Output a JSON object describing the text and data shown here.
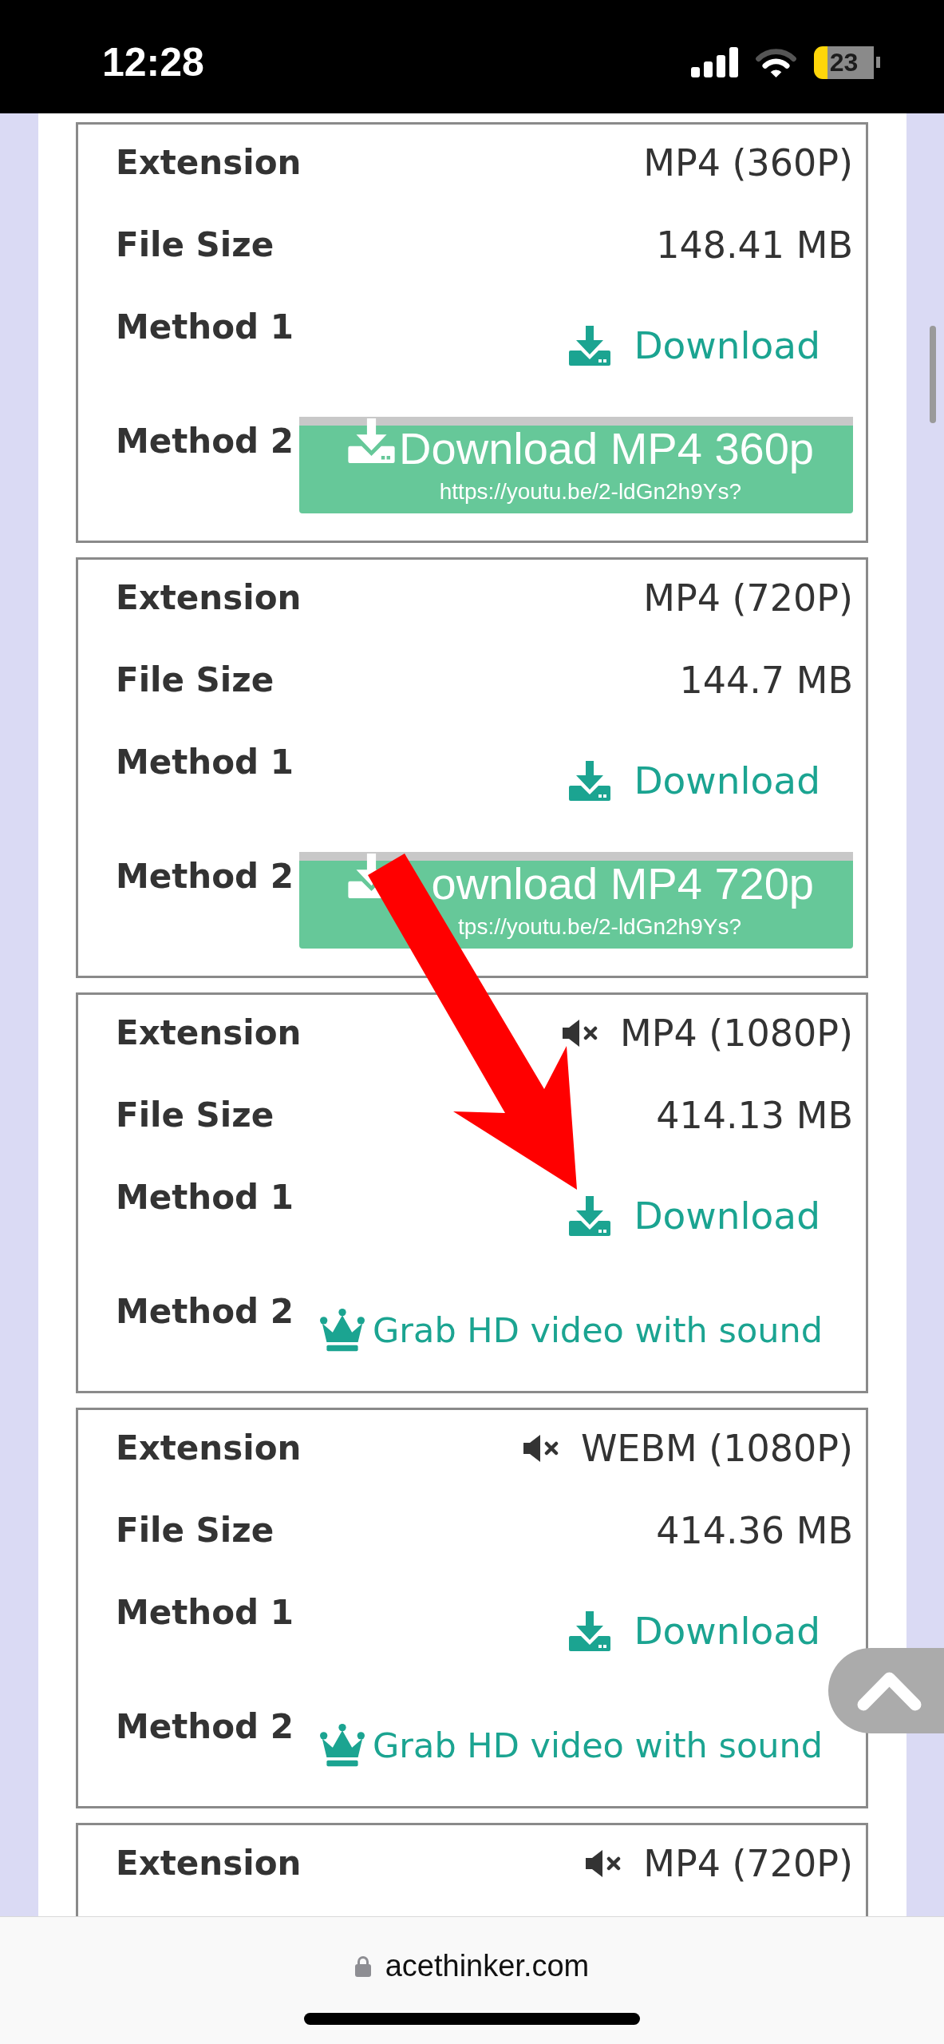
{
  "status_bar": {
    "time": "12:28",
    "battery": "23"
  },
  "cards": [
    {
      "rows": [
        {
          "kind": "value",
          "label": "Extension",
          "value": "MP4 (360P)",
          "no_audio": false
        },
        {
          "kind": "value",
          "label": "File Size",
          "value": "148.41 MB"
        },
        {
          "kind": "download",
          "label": "Method 1",
          "text": "Download"
        },
        {
          "kind": "button",
          "label": "Method 2",
          "title": "Download MP4 360p",
          "url": "https://youtu.be/2-ldGn2h9Ys?"
        }
      ]
    },
    {
      "rows": [
        {
          "kind": "value",
          "label": "Extension",
          "value": "MP4 (720P)",
          "no_audio": false
        },
        {
          "kind": "value",
          "label": "File Size",
          "value": "144.7 MB"
        },
        {
          "kind": "download",
          "label": "Method 1",
          "text": "Download"
        },
        {
          "kind": "button",
          "label": "Method 2",
          "title": "ownload MP4 720p",
          "url": "tps://youtu.be/2-ldGn2h9Ys?"
        }
      ]
    },
    {
      "rows": [
        {
          "kind": "value",
          "label": "Extension",
          "value": "MP4 (1080P)",
          "no_audio": true
        },
        {
          "kind": "value",
          "label": "File Size",
          "value": "414.13 MB"
        },
        {
          "kind": "download",
          "label": "Method 1",
          "text": "Download"
        },
        {
          "kind": "premium",
          "label": "Method 2",
          "text": "Grab HD video with sound"
        }
      ]
    },
    {
      "rows": [
        {
          "kind": "value",
          "label": "Extension",
          "value": "WEBM (1080P)",
          "no_audio": true
        },
        {
          "kind": "value",
          "label": "File Size",
          "value": "414.36 MB"
        },
        {
          "kind": "download",
          "label": "Method 1",
          "text": "Download"
        },
        {
          "kind": "premium",
          "label": "Method 2",
          "text": "Grab HD video with sound"
        }
      ]
    },
    {
      "rows": [
        {
          "kind": "value",
          "label": "Extension",
          "value": "MP4 (720P)",
          "no_audio": true
        }
      ]
    }
  ],
  "address_bar": {
    "domain": "acethinker.com"
  }
}
